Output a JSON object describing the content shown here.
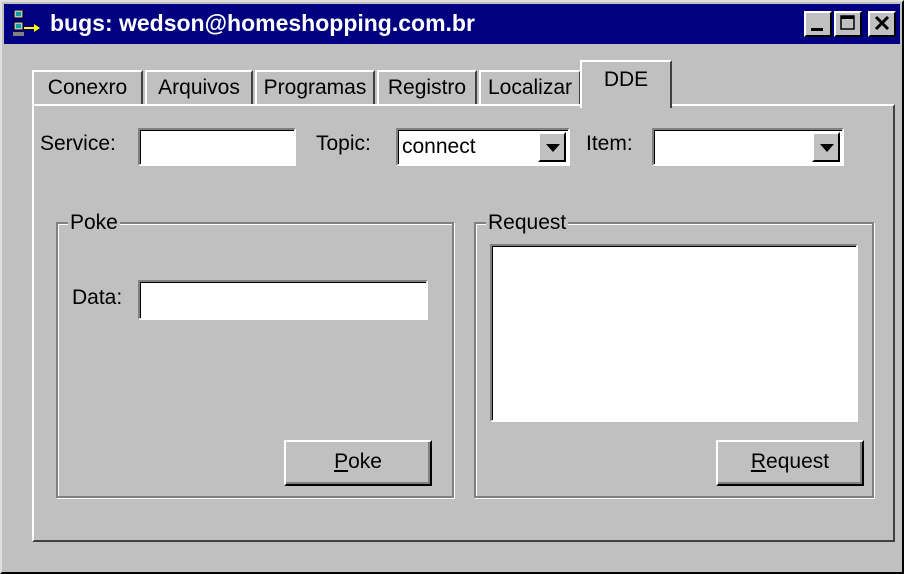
{
  "window": {
    "title": "bugs: wedson@homeshopping.com.br",
    "app_icon": "network-computer-icon",
    "controls": {
      "minimize": "minimize-icon",
      "maximize": "maximize-icon",
      "close": "close-icon"
    }
  },
  "tabs": [
    {
      "label": "Conexro",
      "active": false
    },
    {
      "label": "Arquivos",
      "active": false
    },
    {
      "label": "Programas",
      "active": false
    },
    {
      "label": "Registro",
      "active": false
    },
    {
      "label": "Localizar",
      "active": false
    },
    {
      "label": "DDE",
      "active": true
    }
  ],
  "dde": {
    "service_label": "Service:",
    "service_value": "",
    "topic_label": "Topic:",
    "topic_value": "connect",
    "item_label": "Item:",
    "item_value": "",
    "poke": {
      "legend": "Poke",
      "data_label": "Data:",
      "data_value": "",
      "button_mnemonic": "P",
      "button_rest": "oke"
    },
    "request": {
      "legend": "Request",
      "output": "",
      "button_mnemonic": "R",
      "button_rest": "equest"
    }
  },
  "colors": {
    "title_bar": "#000080",
    "face": "#c0c0c0",
    "field": "#ffffff"
  }
}
